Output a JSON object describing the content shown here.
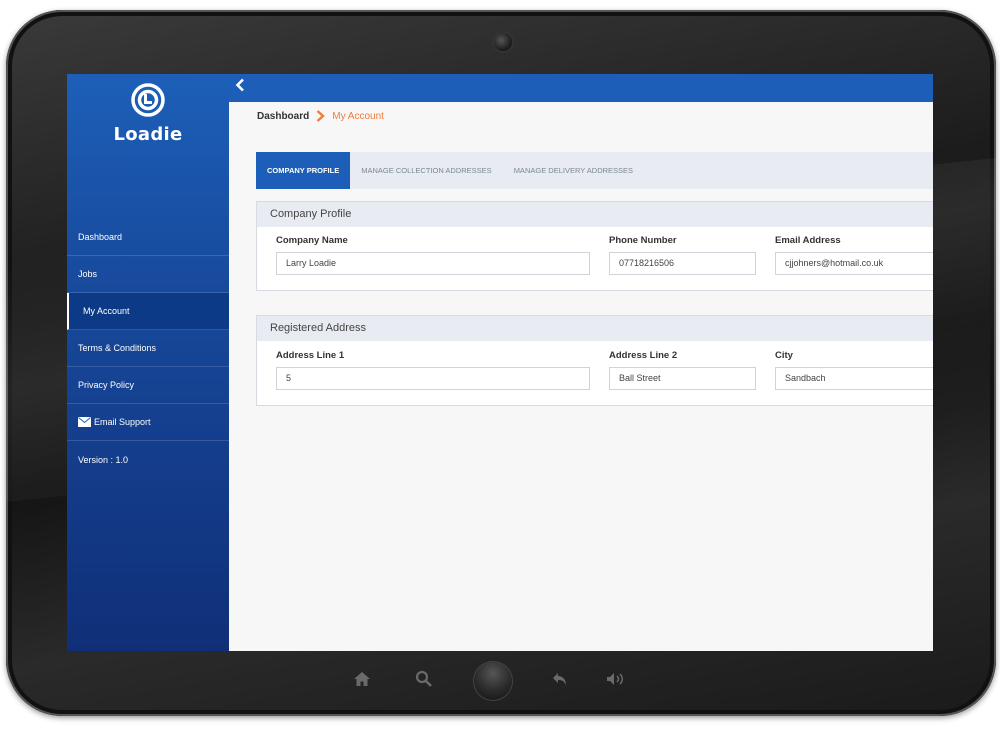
{
  "device": {
    "camera_left_text": "",
    "camera_right_text": ""
  },
  "app": {
    "name": "Loadie",
    "back_symbol": "<"
  },
  "sidebar": {
    "items": [
      {
        "label": "Dashboard"
      },
      {
        "label": "Jobs"
      },
      {
        "label": "My Account"
      },
      {
        "label": "Terms & Conditions"
      },
      {
        "label": "Privacy Policy"
      },
      {
        "label": "Email Support",
        "icon": "mail-icon"
      },
      {
        "label": "Version : 1.0"
      }
    ],
    "active_item": "My Account"
  },
  "breadcrumb": {
    "root": "Dashboard",
    "current": "My Account"
  },
  "tabs": [
    {
      "label": "COMPANY PROFILE",
      "active": true
    },
    {
      "label": "MANAGE COLLECTION ADDRESSES",
      "active": false
    },
    {
      "label": "MANAGE DELIVERY ADDRESSES",
      "active": false
    }
  ],
  "company_profile": {
    "title": "Company Profile",
    "company_name": {
      "label": "Company Name",
      "value": "Larry Loadie"
    },
    "phone": {
      "label": "Phone Number",
      "value": "07718216506"
    },
    "email": {
      "label": "Email Address",
      "value": "cjjohners@hotmail.co.uk"
    }
  },
  "registered_address": {
    "title": "Registered Address",
    "line1": {
      "label": "Address Line 1",
      "value": "5"
    },
    "line2": {
      "label": "Address Line 2",
      "value": "Ball Street"
    },
    "city": {
      "label": "City",
      "value": "Sandbach"
    }
  },
  "colors": {
    "primary": "#1d5fb8",
    "accent": "#f07c3c",
    "sidebar_dark": "#102f78"
  }
}
